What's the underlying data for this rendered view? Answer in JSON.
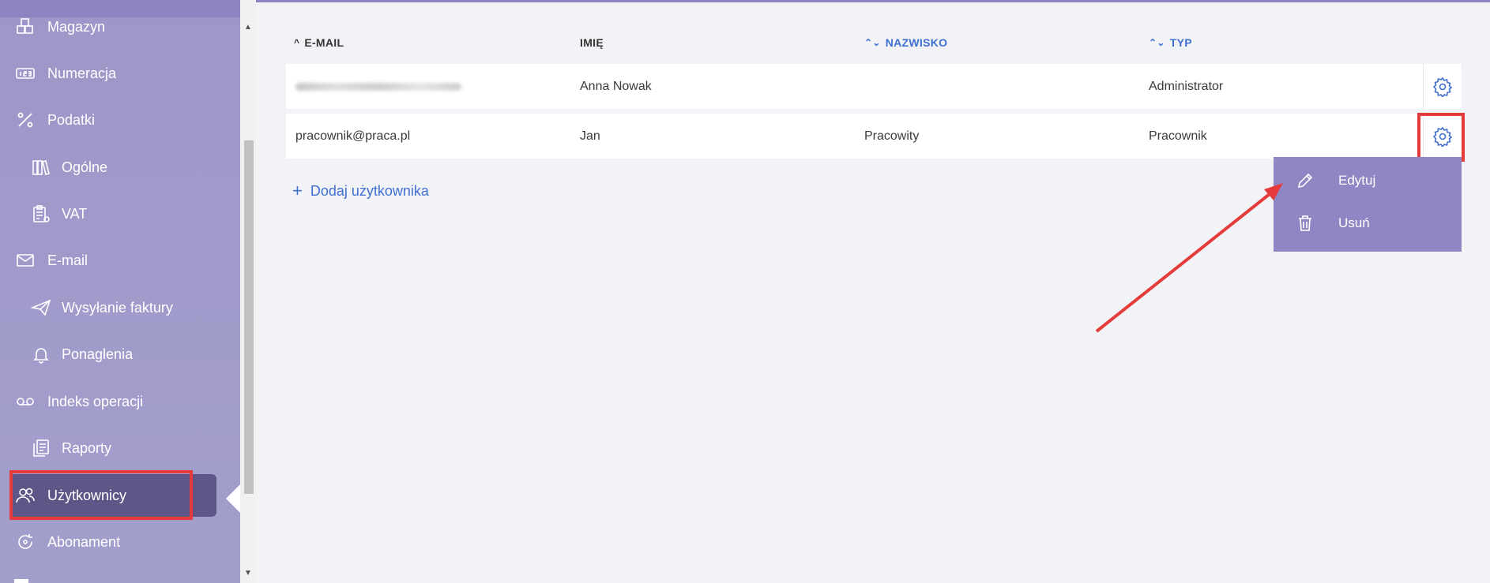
{
  "colors": {
    "sidebar": "#9d97c9",
    "sidebar_active": "#5e5686",
    "accent_blue": "#3f6fd0",
    "menu_bg": "#8e87c3",
    "highlight_red": "#e53b3b"
  },
  "sidebar": {
    "items": [
      {
        "label": "Magazyn",
        "icon": "boxes-icon"
      },
      {
        "label": "Numeracja",
        "icon": "numbering-icon"
      },
      {
        "label": "Podatki",
        "icon": "percent-icon"
      },
      {
        "label": "Ogólne",
        "icon": "books-icon"
      },
      {
        "label": "VAT",
        "icon": "clipboard-icon"
      },
      {
        "label": "E-mail",
        "icon": "envelope-icon"
      },
      {
        "label": "Wysyłanie faktury",
        "icon": "paper-plane-icon"
      },
      {
        "label": "Ponaglenia",
        "icon": "bell-icon"
      },
      {
        "label": "Indeks operacji",
        "icon": "voicemail-icon"
      },
      {
        "label": "Raporty",
        "icon": "documents-icon"
      },
      {
        "label": "Użytkownicy",
        "icon": "users-icon",
        "active": true
      },
      {
        "label": "Abonament",
        "icon": "refresh-icon"
      }
    ]
  },
  "table": {
    "columns": [
      {
        "label": "E-MAIL",
        "sort": "asc"
      },
      {
        "label": "IMIĘ",
        "sort": "none"
      },
      {
        "label": "NAZWISKO",
        "sort": "both"
      },
      {
        "label": "TYP",
        "sort": "both"
      }
    ],
    "rows": [
      {
        "email": "",
        "first_name": "Anna Nowak",
        "last_name": "",
        "type": "Administrator",
        "email_blurred": true
      },
      {
        "email": "pracownik@praca.pl",
        "first_name": "Jan",
        "last_name": "Pracowity",
        "type": "Pracownik"
      }
    ],
    "add_user_label": "Dodaj użytkownika"
  },
  "context_menu": {
    "items": [
      {
        "label": "Edytuj",
        "icon": "pencil-icon"
      },
      {
        "label": "Usuń",
        "icon": "trash-icon"
      }
    ]
  }
}
